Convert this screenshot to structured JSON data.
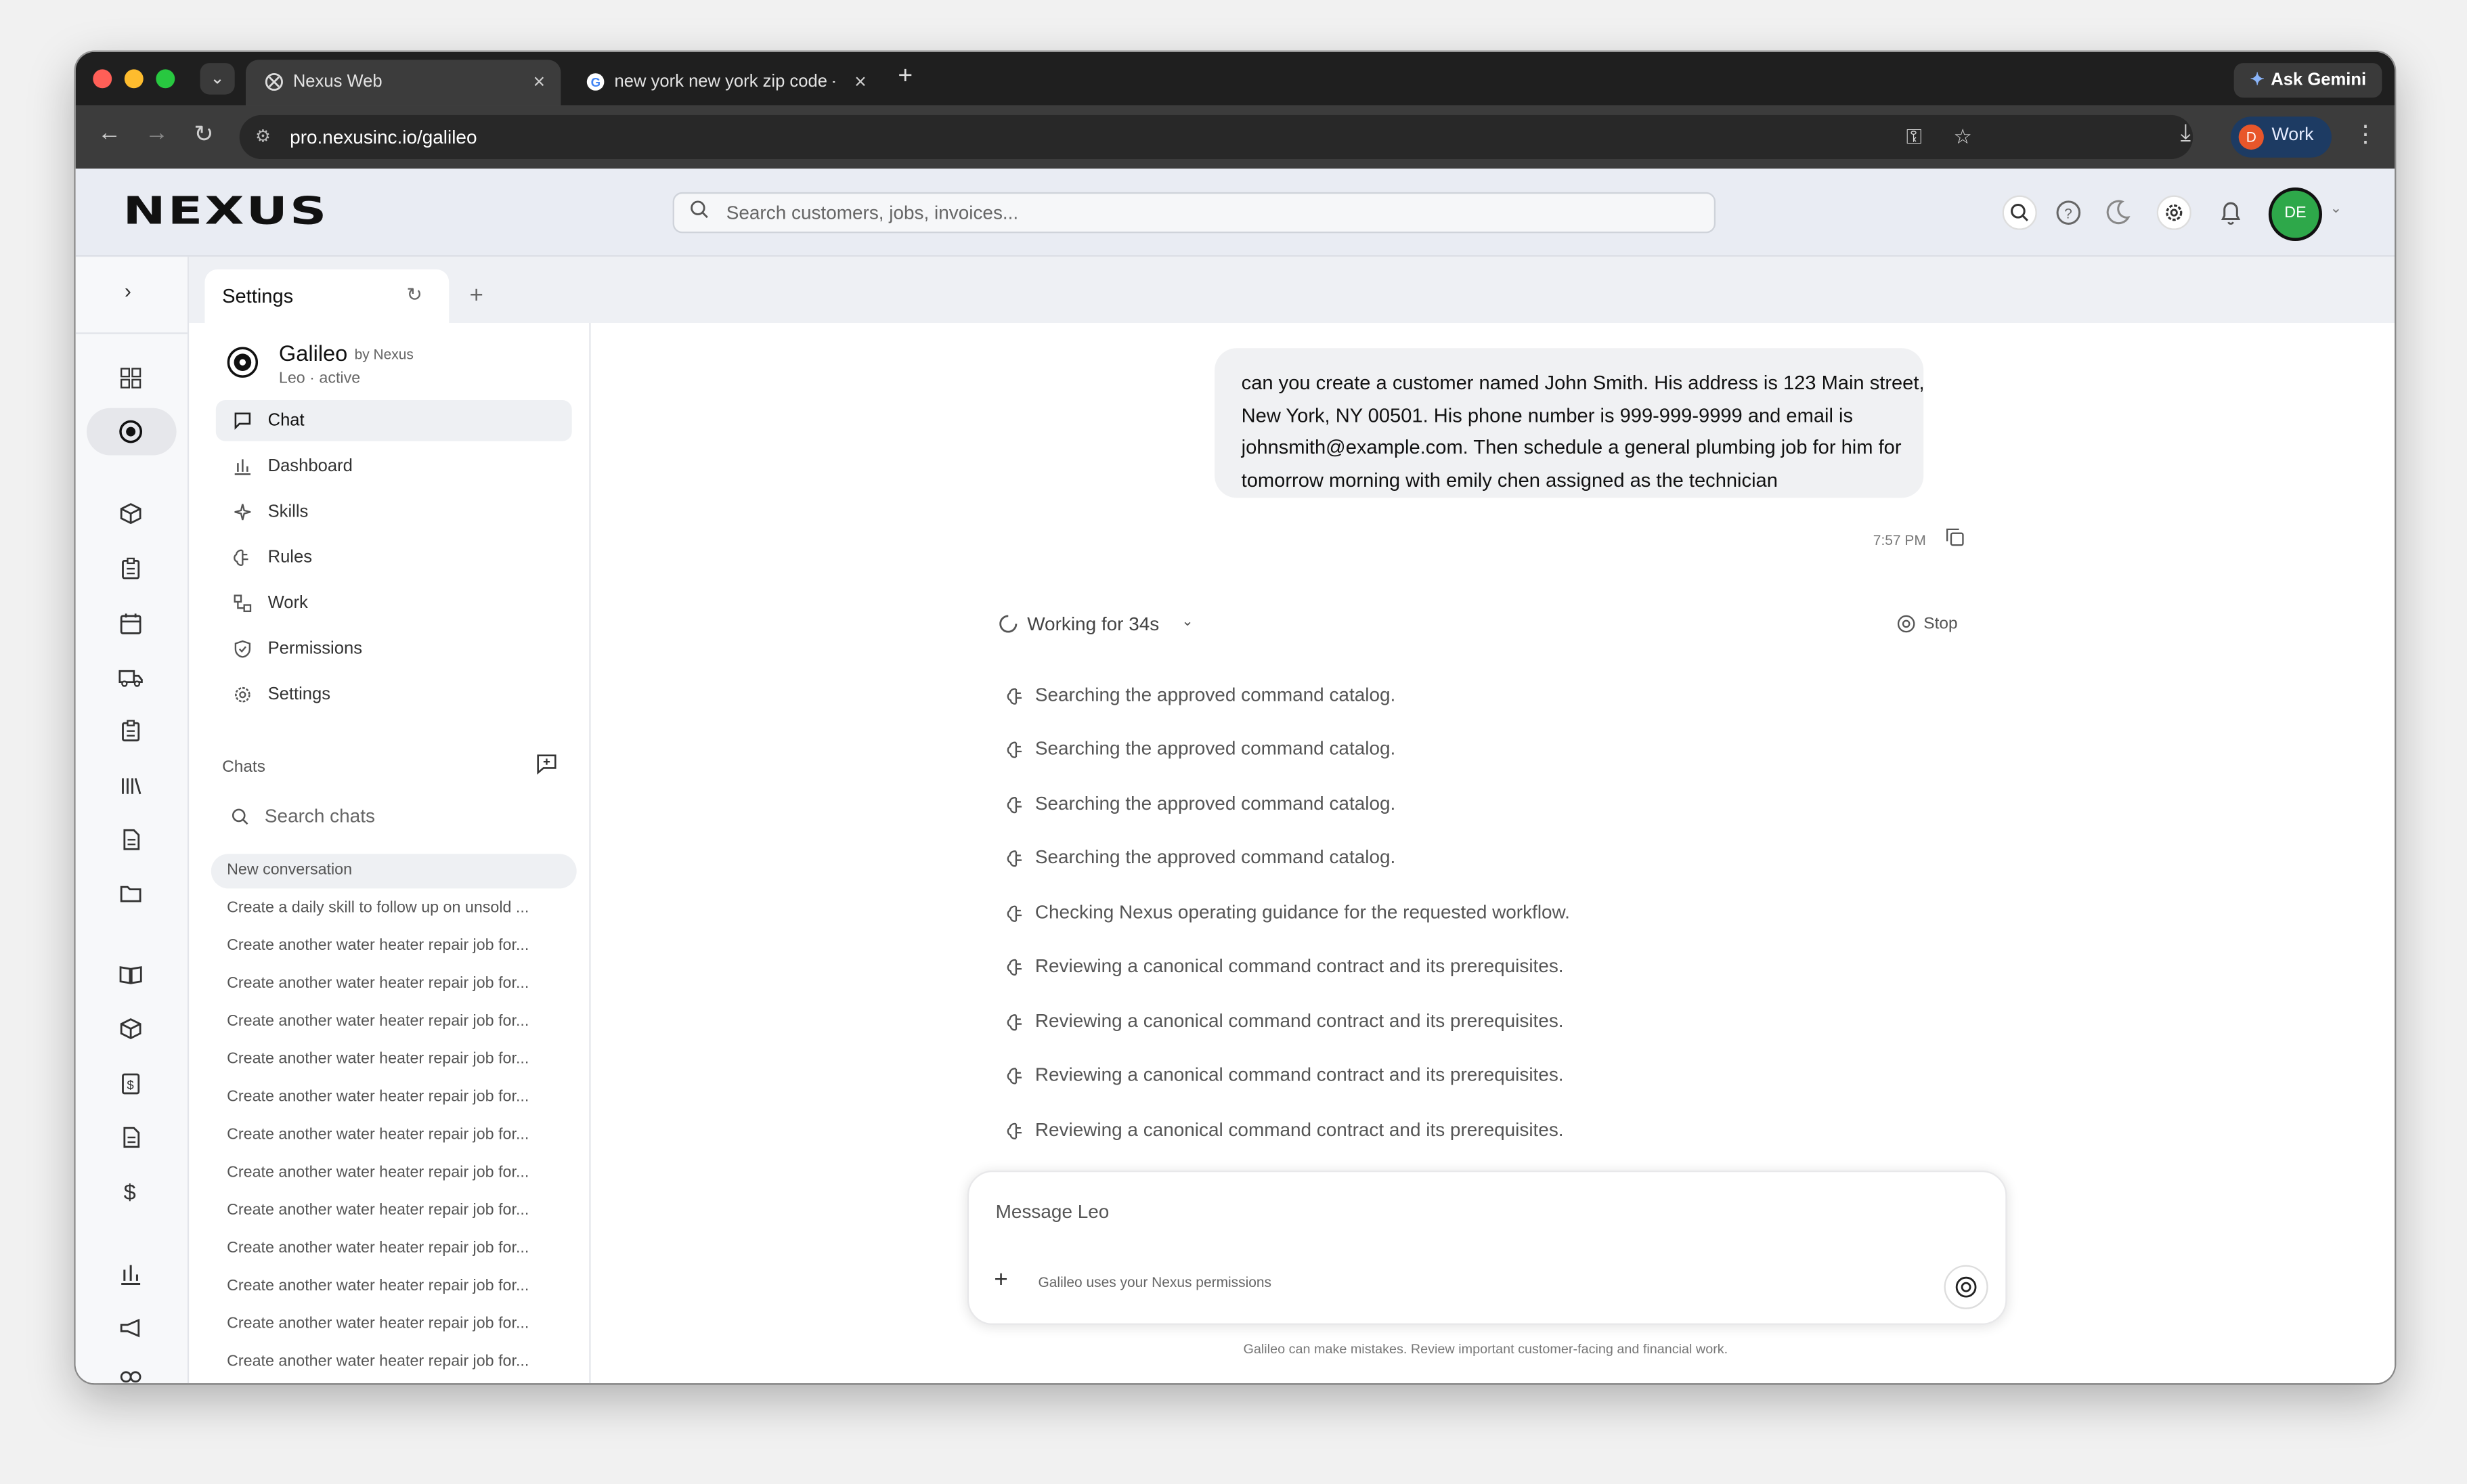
{
  "browser": {
    "tabs": [
      {
        "title": "Nexus Web"
      },
      {
        "title": "new york new york zip code -"
      }
    ],
    "url": "pro.nexusinc.io/galileo",
    "gemini_label": "Ask Gemini",
    "profile_initial": "D",
    "profile_label": "Work"
  },
  "app": {
    "logo": "NEXUS",
    "search_placeholder": "Search customers, jobs, invoices...",
    "avatar_initials": "DE",
    "settings_tab": "Settings"
  },
  "galileo": {
    "name": "Galileo",
    "by": "by Nexus",
    "subtitle": "Leo · active",
    "nav": [
      {
        "label": "Chat",
        "icon": "chat-icon"
      },
      {
        "label": "Dashboard",
        "icon": "bar-chart-icon"
      },
      {
        "label": "Skills",
        "icon": "sparkle-icon"
      },
      {
        "label": "Rules",
        "icon": "brain-icon"
      },
      {
        "label": "Work",
        "icon": "workflow-icon"
      },
      {
        "label": "Permissions",
        "icon": "shield-icon"
      },
      {
        "label": "Settings",
        "icon": "gear-icon"
      }
    ],
    "chats_label": "Chats",
    "search_chats": "Search chats",
    "chats": [
      "New conversation",
      "Create a daily skill to follow up on unsold ...",
      "Create another water heater repair job for...",
      "Create another water heater repair job for...",
      "Create another water heater repair job for...",
      "Create another water heater repair job for...",
      "Create another water heater repair job for...",
      "Create another water heater repair job for...",
      "Create another water heater repair job for...",
      "Create another water heater repair job for...",
      "Create another water heater repair job for...",
      "Create another water heater repair job for...",
      "Create another water heater repair job for...",
      "Create another water heater repair job for..."
    ]
  },
  "conversation": {
    "user_message": "can you create a customer named John Smith. His address is 123 Main street, New York, NY 00501. His phone number is 999-999-9999 and email is johnsmith@example.com. Then schedule a general plumbing job for him for tomorrow morning with emily chen assigned as the technician",
    "time": "7:57 PM",
    "working": "Working for 34s",
    "stop": "Stop",
    "steps": [
      "Searching the approved command catalog.",
      "Searching the approved command catalog.",
      "Searching the approved command catalog.",
      "Searching the approved command catalog.",
      "Checking Nexus operating guidance for the requested workflow.",
      "Reviewing a canonical command contract and its prerequisites.",
      "Reviewing a canonical command contract and its prerequisites.",
      "Reviewing a canonical command contract and its prerequisites.",
      "Reviewing a canonical command contract and its prerequisites."
    ]
  },
  "composer": {
    "placeholder": "Message Leo",
    "permissions_note": "Galileo uses your Nexus permissions",
    "disclaimer": "Galileo can make mistakes. Review important customer-facing and financial work."
  }
}
